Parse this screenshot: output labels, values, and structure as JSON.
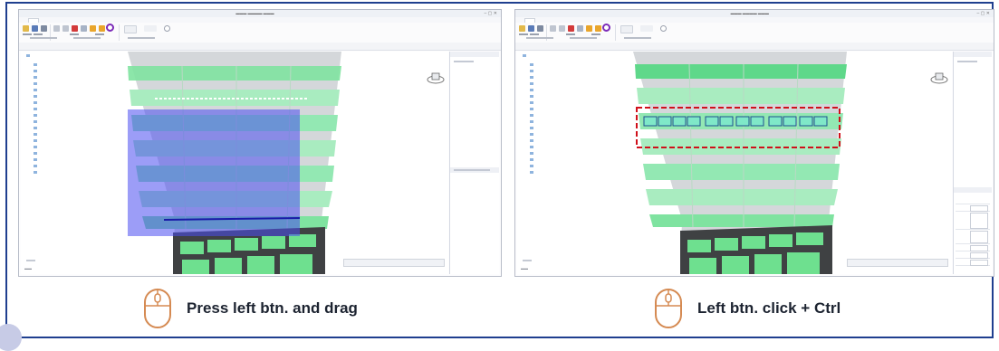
{
  "panels": [
    {
      "id": "left",
      "mode": "box-select-drag",
      "tree_items": 14
    },
    {
      "id": "right",
      "mode": "ctrl-click-select",
      "tree_items": 14
    }
  ],
  "captions": {
    "left": "Press left btn. and drag",
    "right": "Left btn. click + Ctrl"
  },
  "icons": {
    "mouse": "mouse-left-button-icon",
    "nav_cube": "navigation-cube-icon"
  },
  "colors": {
    "frame_border": "#1f3f8f",
    "selection_rect": "#4a4cf0",
    "highlight_dash": "#d0101a",
    "glass_green": "#7fe3a0",
    "slab_grey": "#c9cccf",
    "mouse_outline": "#d58a52"
  }
}
